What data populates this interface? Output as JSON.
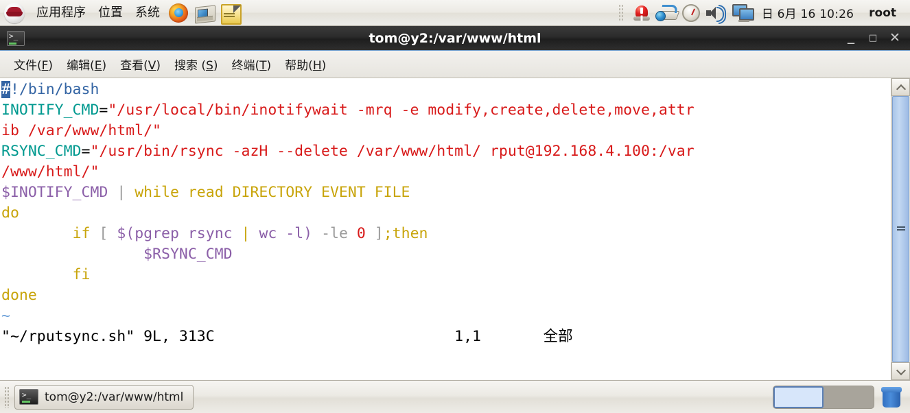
{
  "top_panel": {
    "logo": "redhat-logo",
    "menus": [
      {
        "label": "应用程序",
        "name": "menu-applications"
      },
      {
        "label": "位置",
        "name": "menu-places"
      },
      {
        "label": "系统",
        "name": "menu-system"
      }
    ],
    "launchers": [
      {
        "name": "firefox-icon",
        "title": "Firefox"
      },
      {
        "name": "evolution-icon",
        "title": "Evolution"
      },
      {
        "name": "gedit-icon",
        "title": "gedit"
      }
    ],
    "tray_icons": [
      {
        "name": "alert-icon"
      },
      {
        "name": "network-icon"
      },
      {
        "name": "gauge-icon"
      },
      {
        "name": "volume-icon"
      },
      {
        "name": "displays-icon"
      }
    ],
    "clock": "日 6月 16 10:26",
    "user": "root"
  },
  "window": {
    "title": "tom@y2:/var/www/html",
    "icon": "terminal-icon",
    "buttons": {
      "minimize": "_",
      "maximize": "□",
      "close": "✕"
    }
  },
  "menubar": [
    {
      "name": "menu-file",
      "pre": "文件(",
      "key": "F",
      "post": ")"
    },
    {
      "name": "menu-edit",
      "pre": "编辑(",
      "key": "E",
      "post": ")"
    },
    {
      "name": "menu-view",
      "pre": "查看(",
      "key": "V",
      "post": ")"
    },
    {
      "name": "menu-search",
      "pre": "搜索 (",
      "key": "S",
      "post": ")"
    },
    {
      "name": "menu-terminal",
      "pre": "终端(",
      "key": "T",
      "post": ")"
    },
    {
      "name": "menu-help",
      "pre": "帮助(",
      "key": "H",
      "post": ")"
    }
  ],
  "terminal": {
    "editor": "vim",
    "file": "~/rputsync.sh",
    "lines": [
      "#!/bin/bash",
      "INOTIFY_CMD=\"/usr/local/bin/inotifywait -mrq -e modify,create,delete,move,attrib /var/www/html/\"",
      "RSYNC_CMD=\"/usr/bin/rsync -azH --delete /var/www/html/ rput@192.168.4.100:/var/www/html/\"",
      "$INOTIFY_CMD | while read DIRECTORY EVENT FILE",
      "do",
      "        if [ $(pgrep rsync | wc -l) -le 0 ];then",
      "                $RSYNC_CMD",
      "        fi",
      "done",
      "~"
    ],
    "status_left": "\"~/rputsync.sh\" 9L, 313C",
    "status_position": "1,1",
    "status_right": "全部",
    "cursor": {
      "row": 1,
      "col": 1,
      "char": "#"
    }
  },
  "scrollbar": {
    "up_arrow": "scroll-up-icon",
    "down_arrow": "scroll-down-icon"
  },
  "taskbar": {
    "tasks": [
      {
        "name": "taskbar-item-terminal",
        "label": "tom@y2:/var/www/html",
        "icon": "terminal-icon"
      }
    ],
    "workspaces": [
      {
        "name": "workspace-1",
        "active": true
      },
      {
        "name": "workspace-2",
        "active": false
      }
    ],
    "trash": "trash-icon"
  },
  "colors": {
    "comment": "#3465a4",
    "variable": "#00998f",
    "string": "#d81a1a",
    "dollar_var": "#8b5fa8",
    "keyword": "#c8a40a",
    "pipe": "#9a9a9a",
    "number": "#d81a1a",
    "tilde": "#6a9fd8",
    "cursor_bg": "#3465a4",
    "scrollbar": "#a8c4e8",
    "titlebar": "#2b2b2b"
  }
}
